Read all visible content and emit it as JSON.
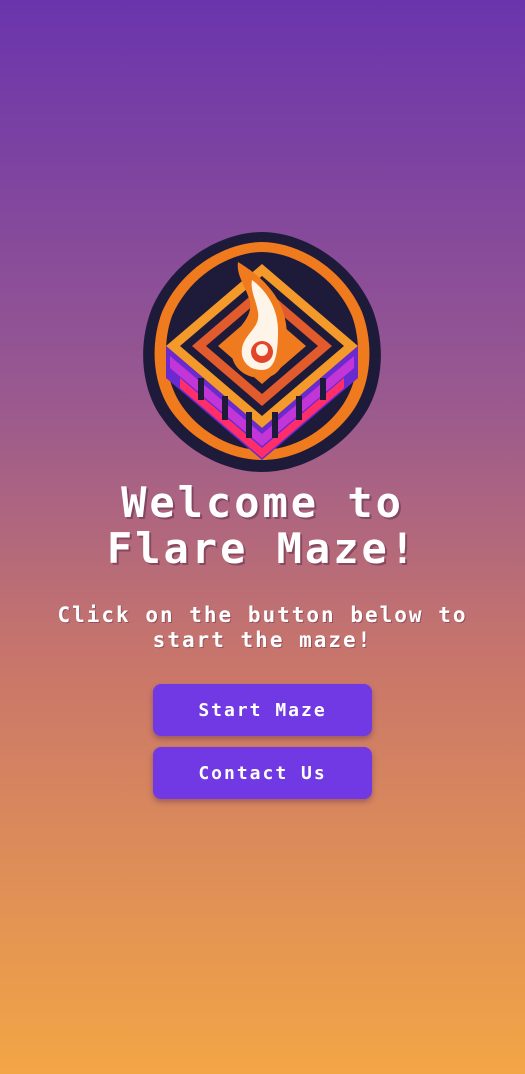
{
  "logo": {
    "icon": "flame-maze-logo-icon",
    "colors": {
      "outline": "#1e1b3a",
      "orange": "#f07a1e",
      "magenta": "#c235d6",
      "purple": "#6a2ad0",
      "flame_white": "#fff4e8",
      "pink": "#ff2e6a"
    }
  },
  "hero": {
    "title_line1": "Welcome to",
    "title_line2": "Flare Maze!",
    "subtitle_line1": "Click on the button below to",
    "subtitle_line2": "start the maze!"
  },
  "actions": {
    "start_label": "Start Maze",
    "contact_label": "Contact Us"
  },
  "theme": {
    "gradient_top": "#6a34ad",
    "gradient_bottom": "#f3a645",
    "button_color": "#7039e4"
  }
}
